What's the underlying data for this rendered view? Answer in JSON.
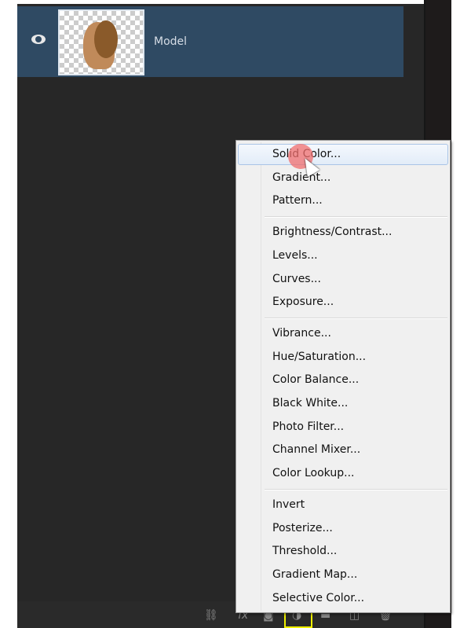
{
  "layer": {
    "name": "Model",
    "selected_color": "#2f4a63"
  },
  "bottom_icons": [
    "link-icon",
    "fx-icon",
    "mask-icon",
    "adjustment-layer-icon",
    "group-folder-icon",
    "new-layer-icon",
    "trash-icon"
  ],
  "menu": {
    "groups": [
      [
        "Solid Color...",
        "Gradient...",
        "Pattern..."
      ],
      [
        "Brightness/Contrast...",
        "Levels...",
        "Curves...",
        "Exposure..."
      ],
      [
        "Vibrance...",
        "Hue/Saturation...",
        "Color Balance...",
        "Black  White...",
        "Photo Filter...",
        "Channel Mixer...",
        "Color Lookup..."
      ],
      [
        "Invert",
        "Posterize...",
        "Threshold...",
        "Gradient Map...",
        "Selective Color..."
      ]
    ],
    "hovered": "Solid Color..."
  },
  "highlight_color": "#f0f000"
}
